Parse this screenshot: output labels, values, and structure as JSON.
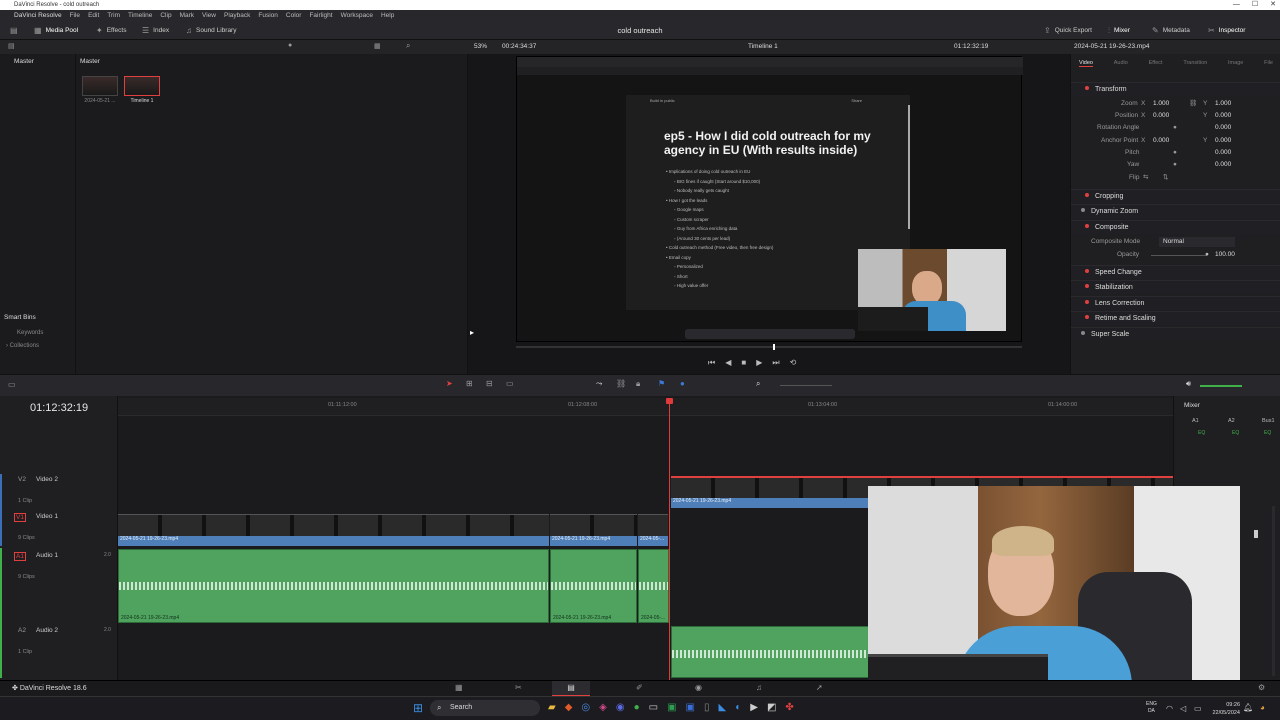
{
  "window": {
    "title": "DaVinci Resolve - cold outreach",
    "controls": [
      "—",
      "☐",
      "✕"
    ]
  },
  "menu": [
    "DaVinci Resolve",
    "File",
    "Edit",
    "Trim",
    "Timeline",
    "Clip",
    "Mark",
    "View",
    "Playback",
    "Fusion",
    "Color",
    "Fairlight",
    "Workspace",
    "Help"
  ],
  "toolbar": {
    "media_pool": "Media Pool",
    "effects": "Effects",
    "index": "Index",
    "sound_library": "Sound Library",
    "project_title": "cold outreach",
    "quick_export": "Quick Export",
    "mixer": "Mixer",
    "metadata": "Metadata",
    "inspector": "Inspector"
  },
  "toolbar2": {
    "zoom": "53%",
    "duration": "00:24:34:37",
    "timeline_name": "Timeline 1",
    "timecode": "01:12:32:19",
    "clip_name": "2024-05-21 19-26-23.mp4"
  },
  "media": {
    "master_label": "Master",
    "pool_label": "Master",
    "items": [
      {
        "name": "2024-05-21 ..."
      },
      {
        "name": "Timeline 1"
      }
    ],
    "smart_bins": "Smart Bins",
    "keywords": "Keywords",
    "collections": "Collections"
  },
  "viewer_doc": {
    "breadcrumb": "Build in public",
    "share": "Share",
    "title": "ep5 - How I did cold outreach for my agency in EU (With results inside)",
    "bullets": [
      {
        "text": "Implications of doing cold outreach in EU",
        "level": 0
      },
      {
        "text": "BIG fines if caught (Start around $10,000)",
        "level": 1
      },
      {
        "text": "Nobody really gets caught",
        "level": 1
      },
      {
        "text": "How I got the leads",
        "level": 0
      },
      {
        "text": "Google maps",
        "level": 1
      },
      {
        "text": "Custom scraper",
        "level": 1
      },
      {
        "text": "Guy from Africa enriching data",
        "level": 1
      },
      {
        "text": "(Around 30 cents per lead)",
        "level": 1
      },
      {
        "text": "Cold outreach method (Free video, then free design)",
        "level": 0
      },
      {
        "text": "Email copy",
        "level": 0
      },
      {
        "text": "Personalized",
        "level": 1
      },
      {
        "text": "Short",
        "level": 1
      },
      {
        "text": "High value offer",
        "level": 1
      }
    ]
  },
  "inspector": {
    "tabs": [
      "Video",
      "Audio",
      "Effect",
      "Transition",
      "Image",
      "File"
    ],
    "transform": "Transform",
    "zoom_label": "Zoom",
    "zoom_x": "1.000",
    "zoom_y": "1.000",
    "position_label": "Position",
    "pos_x": "0.000",
    "pos_y": "0.000",
    "rotation_label": "Rotation Angle",
    "rotation": "0.000",
    "anchor_label": "Anchor Point",
    "anchor_x": "0.000",
    "anchor_y": "0.000",
    "pitch_label": "Pitch",
    "pitch": "0.000",
    "yaw_label": "Yaw",
    "yaw": "0.000",
    "flip_label": "Flip",
    "x": "X",
    "y": "Y",
    "cropping": "Cropping",
    "dynamic_zoom": "Dynamic Zoom",
    "composite": "Composite",
    "composite_mode_label": "Composite Mode",
    "composite_mode": "Normal",
    "opacity_label": "Opacity",
    "opacity": "100.00",
    "speed_change": "Speed Change",
    "stabilization": "Stabilization",
    "lens_correction": "Lens Correction",
    "retime": "Retime and Scaling",
    "super_scale": "Super Scale"
  },
  "timeline": {
    "timecode": "01:12:32:19",
    "ruler": [
      "01:11:12:00",
      "01:12:08:00",
      "01:13:04:00",
      "01:14:00:00"
    ],
    "tracks": [
      {
        "id": "V2",
        "name": "Video 2",
        "clips": "1 Clip"
      },
      {
        "id": "V1",
        "name": "Video 1",
        "clips": "9 Clips"
      },
      {
        "id": "A1",
        "name": "Audio 1",
        "clips": "9 Clips",
        "ch": "2.0"
      },
      {
        "id": "A2",
        "name": "Audio 2",
        "clips": "1 Clip",
        "ch": "2.0"
      }
    ],
    "clip_name": "2024-05-21 19-26-23.mp4",
    "clip_short": "2024-05-..."
  },
  "mixer_panel": {
    "title": "Mixer",
    "channels": [
      "A1",
      "A2",
      "Bus1"
    ],
    "eq": "EQ"
  },
  "footer": {
    "brand": "DaVinci Resolve 18.6"
  },
  "taskbar": {
    "search": "Search",
    "lang": "ENG",
    "region": "DA",
    "time": "09:26",
    "date": "22/05/2024"
  }
}
